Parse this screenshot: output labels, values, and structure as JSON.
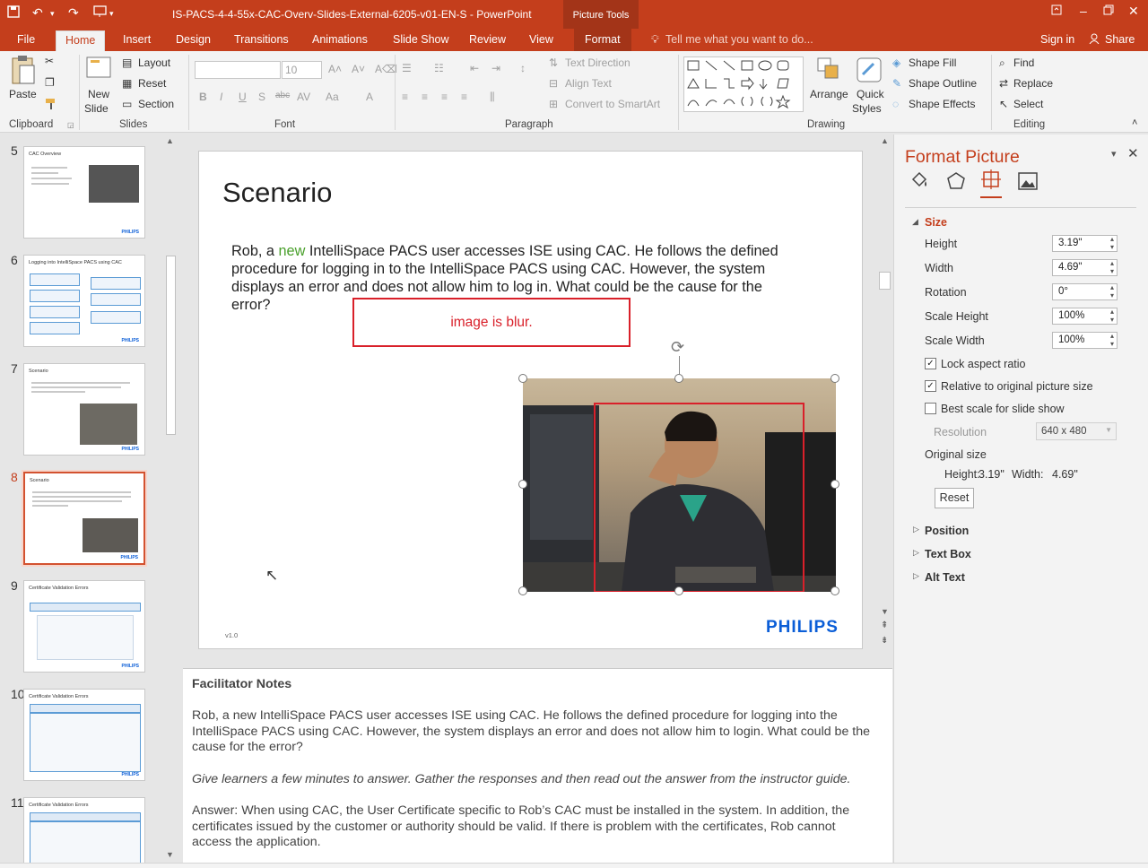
{
  "window": {
    "title": "IS-PACS-4-4-55x-CAC-Overv-Slides-External-6205-v01-EN-S - PowerPoint",
    "context_tab_group": "Picture Tools"
  },
  "tabs": [
    "File",
    "Home",
    "Insert",
    "Design",
    "Transitions",
    "Animations",
    "Slide Show",
    "Review",
    "View",
    "Format"
  ],
  "tell_me": "Tell me what you want to do...",
  "account": {
    "sign_in": "Sign in",
    "share": "Share"
  },
  "ribbon": {
    "clipboard": {
      "paste": "Paste",
      "label": "Clipboard"
    },
    "slides": {
      "new_slide_1": "New",
      "new_slide_2": "Slide",
      "layout": "Layout",
      "reset": "Reset",
      "section": "Section",
      "label": "Slides"
    },
    "font": {
      "size": "10",
      "label": "Font"
    },
    "paragraph": {
      "text_direction": "Text Direction",
      "align_text": "Align Text",
      "convert_smartart": "Convert to SmartArt",
      "label": "Paragraph"
    },
    "drawing": {
      "arrange": "Arrange",
      "quick_styles_1": "Quick",
      "quick_styles_2": "Styles",
      "shape_fill": "Shape Fill",
      "shape_outline": "Shape Outline",
      "shape_effects": "Shape Effects",
      "label": "Drawing"
    },
    "editing": {
      "find": "Find",
      "replace": "Replace",
      "select": "Select",
      "label": "Editing"
    }
  },
  "thumbnails": [
    {
      "num": "5",
      "title": "CAC Overview"
    },
    {
      "num": "6",
      "title": "Logging into IntelliSpace PACS using CAC"
    },
    {
      "num": "7",
      "title": "Scenario"
    },
    {
      "num": "8",
      "title": "Scenario"
    },
    {
      "num": "9",
      "title": "Certificate Validation Errors"
    },
    {
      "num": "10",
      "title": "Certificate Validation Errors"
    },
    {
      "num": "11",
      "title": "Certificate Validation Errors"
    }
  ],
  "thumb_logo": "PHILIPS",
  "slide": {
    "title": "Scenario",
    "body_before": "Rob, a ",
    "body_highlight": "new",
    "body_after": " IntelliSpace PACS user accesses ISE using CAC. He follows the defined procedure for logging in to the IntelliSpace PACS using CAC. However, the system displays an error and does not allow him to log in. What could be the cause for the error?",
    "annotation": "image is blur.",
    "version": "v1.0",
    "logo": "PHILIPS"
  },
  "notes": {
    "heading": "Facilitator Notes",
    "p1": "Rob, a new IntelliSpace PACS user accesses ISE using CAC. He follows the defined procedure for logging into the IntelliSpace PACS using CAC. However, the system displays an error and does not allow him to login. What could be the cause for the error?",
    "p2": "Give learners a few minutes to answer. Gather the responses and then read out the answer from the instructor guide.",
    "p3": "Answer: When using CAC, the User Certificate specific to Rob’s CAC must be installed in the system. In addition, the certificates issued by the customer or authority should be valid. If there is problem with the certificates, Rob cannot access the application."
  },
  "format_pane": {
    "title": "Format Picture",
    "size_section": "Size",
    "height_label": "Height",
    "height": "3.19\"",
    "width_label": "Width",
    "width": "4.69\"",
    "rotation_label": "Rotation",
    "rotation": "0°",
    "scale_height_label": "Scale Height",
    "scale_height": "100%",
    "scale_width_label": "Scale Width",
    "scale_width": "100%",
    "lock_aspect": "Lock aspect ratio",
    "relative": "Relative to original picture size",
    "best_scale": "Best scale for slide show",
    "resolution_label": "Resolution",
    "resolution": "640 x 480",
    "original_size": "Original size",
    "orig_height_label": "Height:",
    "orig_height": "3.19\"",
    "orig_width_label": "Width:",
    "orig_width": "4.69\"",
    "reset": "Reset",
    "position": "Position",
    "text_box": "Text Box",
    "alt_text": "Alt Text"
  },
  "colors": {
    "accent": "#c43e1c",
    "annotation": "#d9202a",
    "highlight": "#4aa02c",
    "pane_title": "#c43e1c"
  }
}
